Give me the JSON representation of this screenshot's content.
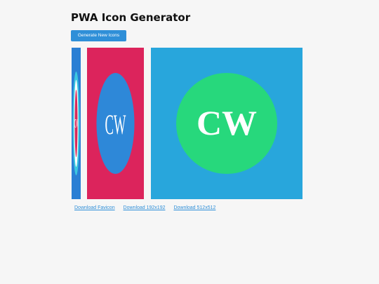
{
  "header": {
    "title": "PWA Icon Generator"
  },
  "toolbar": {
    "generate_label": "Generate New Icons",
    "accent_color": "#2f8fd8"
  },
  "icons": [
    {
      "id": "favicon",
      "background_color": "#2a7fd4",
      "circle_color": "#d62a5a",
      "monogram": "CW"
    },
    {
      "id": "icon-192",
      "background_color": "#dc245c",
      "circle_color": "#2e88d8",
      "monogram": "CW"
    },
    {
      "id": "icon-512",
      "background_color": "#28a6dc",
      "circle_color": "#27d87c",
      "monogram": "CW"
    }
  ],
  "downloads": {
    "favicon_label": "Download Favicon",
    "icon192_label": "Download 192x192",
    "icon512_label": "Download 512x512"
  }
}
